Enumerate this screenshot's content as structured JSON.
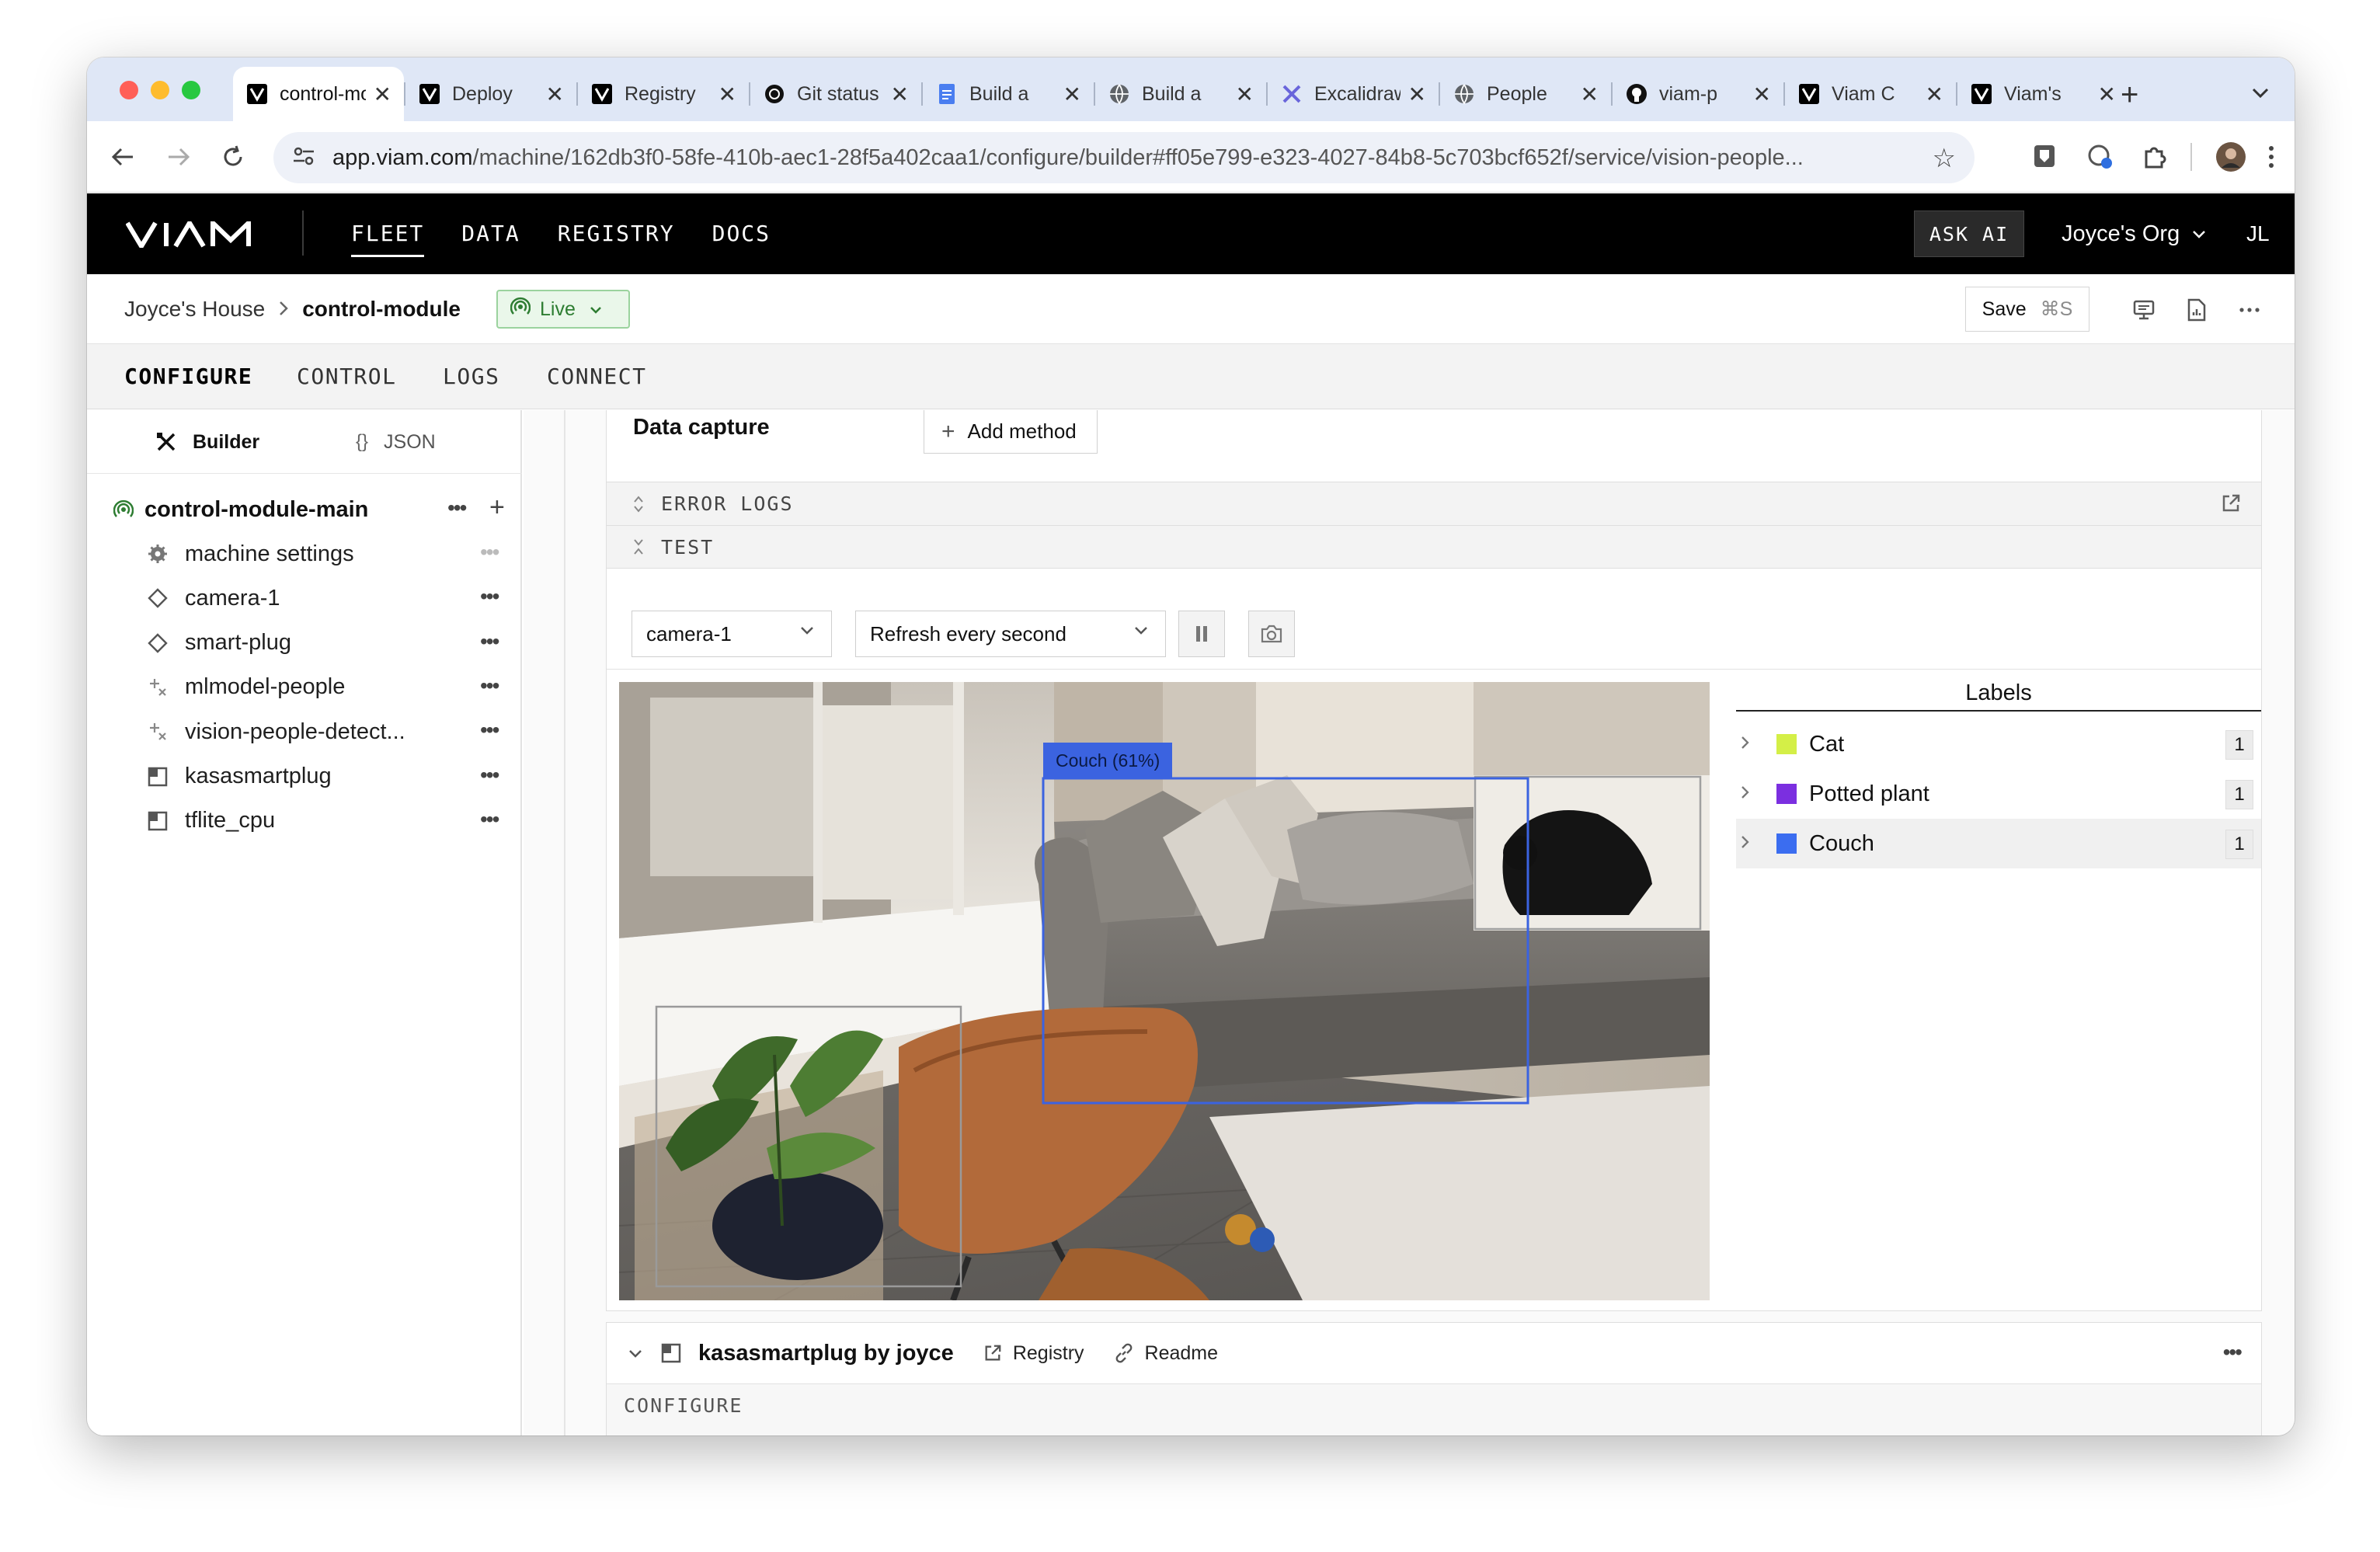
{
  "browser": {
    "tabs": [
      {
        "title": "control-module",
        "icon": "viam-icon",
        "active": true
      },
      {
        "title": "Deploy",
        "icon": "viam-icon"
      },
      {
        "title": "Registry",
        "icon": "viam-icon"
      },
      {
        "title": "Git status",
        "icon": "openai-icon"
      },
      {
        "title": "Build a",
        "icon": "docs-icon"
      },
      {
        "title": "Build a",
        "icon": "globe-icon"
      },
      {
        "title": "Excalidraw",
        "icon": "excalidraw-icon"
      },
      {
        "title": "People",
        "icon": "globe-icon"
      },
      {
        "title": "viam-p",
        "icon": "github-icon"
      },
      {
        "title": "Viam C",
        "icon": "viam-icon"
      },
      {
        "title": "Viam's",
        "icon": "viam-icon"
      }
    ],
    "url_host": "app.viam.com",
    "url_path": "/machine/162db3f0-58fe-410b-aec1-28f5a402caa1/configure/builder#ff05e799-e323-4027-84b8-5c703bcf652f/service/vision-people..."
  },
  "appbar": {
    "logo": "VIAM",
    "nav": [
      "FLEET",
      "DATA",
      "REGISTRY",
      "DOCS"
    ],
    "ask_ai": "ASK AI",
    "org": "Joyce's Org",
    "initials": "JL"
  },
  "breadcrumb": {
    "location": "Joyce's House",
    "machine": "control-module",
    "status": "Live",
    "save": "Save",
    "save_shortcut": "⌘S"
  },
  "subtabs": [
    "CONFIGURE",
    "CONTROL",
    "LOGS",
    "CONNECT"
  ],
  "sidebar": {
    "modes": {
      "builder": "Builder",
      "json": "JSON"
    },
    "root": "control-module-main",
    "items": [
      {
        "label": "machine settings",
        "icon": "gear-icon"
      },
      {
        "label": "camera-1",
        "icon": "component-diamond-icon"
      },
      {
        "label": "smart-plug",
        "icon": "component-diamond-icon"
      },
      {
        "label": "mlmodel-people",
        "icon": "service-sparkle-icon"
      },
      {
        "label": "vision-people-detect...",
        "icon": "service-sparkle-icon"
      },
      {
        "label": "kasasmartplug",
        "icon": "module-square-icon"
      },
      {
        "label": "tflite_cpu",
        "icon": "module-square-icon"
      }
    ]
  },
  "main": {
    "data_capture_label": "Data capture",
    "add_method": "Add method",
    "error_logs": "ERROR LOGS",
    "test": "TEST",
    "camera_select": "camera-1",
    "refresh_select": "Refresh every second",
    "detection_tag": "Couch (61%)",
    "labels_title": "Labels",
    "labels": [
      {
        "name": "Cat",
        "count": "1",
        "color": "#d4ef47"
      },
      {
        "name": "Potted plant",
        "count": "1",
        "color": "#7b2fe0"
      },
      {
        "name": "Couch",
        "count": "1",
        "color": "#3b6df0"
      }
    ],
    "next_card": {
      "title": "kasasmartplug by joyce",
      "registry": "Registry",
      "readme": "Readme",
      "configure": "CONFIGURE"
    }
  },
  "colors": {
    "accent": "#3b63e0",
    "live": "#2e7d32",
    "appbar": "#000000"
  }
}
